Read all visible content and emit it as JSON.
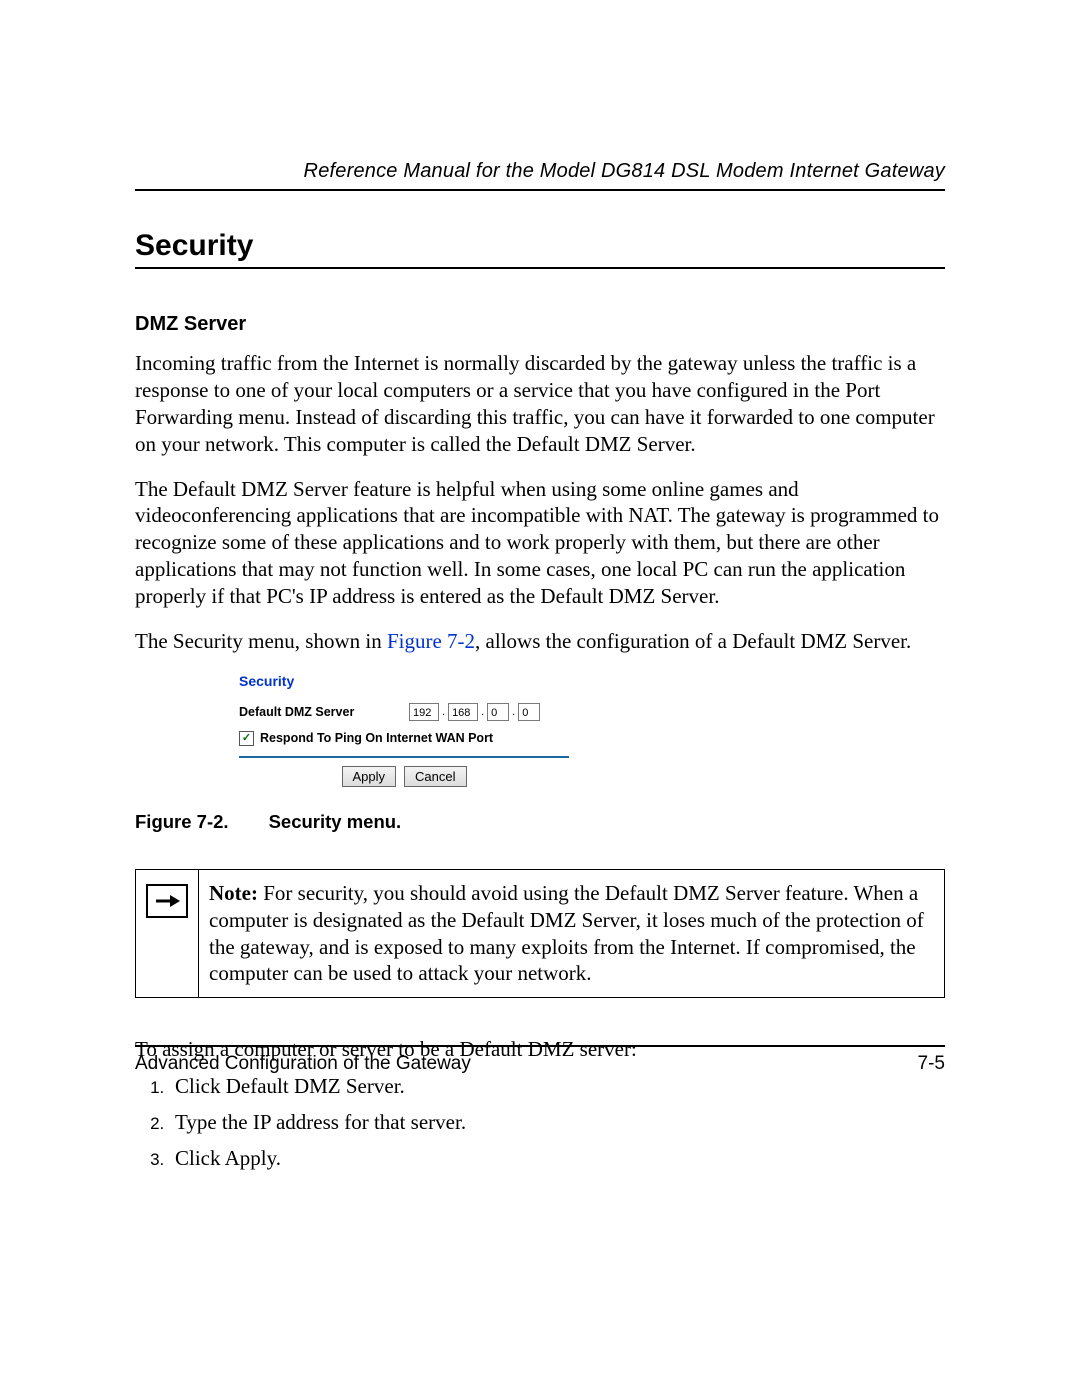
{
  "header": {
    "running": "Reference Manual for the Model DG814 DSL Modem Internet Gateway"
  },
  "section": {
    "title": "Security",
    "sub": "DMZ Server"
  },
  "para1": "Incoming traffic from the Internet is normally discarded by the gateway unless the traffic is a response to one of your local computers or a service that you have configured in the Port Forwarding menu. Instead of discarding this traffic, you can have it forwarded to one computer on your network. This computer is called the Default DMZ Server.",
  "para2": "The Default DMZ Server feature is helpful when using some online games and videoconferencing applications that are incompatible with NAT. The gateway is programmed to recognize some of these applications and to work properly with them, but there are other applications that may not function well. In some cases, one local PC can run the application properly if that PC's IP address is entered as the Default DMZ Server.",
  "para3_a": "The Security menu, shown in ",
  "para3_link": "Figure 7-2",
  "para3_b": ", allows the configuration of a Default DMZ Server.",
  "panel": {
    "title": "Security",
    "dmz_label": "Default DMZ Server",
    "ip": {
      "o1": "192",
      "o2": "168",
      "o3": "0",
      "o4": "0"
    },
    "respond_label": "Respond To Ping On Internet WAN Port",
    "respond_checked": "✓",
    "apply": "Apply",
    "cancel": "Cancel"
  },
  "figure": {
    "num": "Figure 7-2.",
    "title": "Security menu."
  },
  "note": {
    "label": "Note:",
    "text": " For security, you should avoid using the Default DMZ Server feature. When a computer is designated as the Default DMZ Server, it loses much of the protection of the gateway, and is exposed to many exploits from the Internet. If compromised, the computer can be used to attack your network."
  },
  "para4": "To assign a computer or server to be a Default DMZ server:",
  "steps": {
    "s1": "Click Default DMZ Server.",
    "s2": "Type the IP address for that server.",
    "s3": "Click Apply."
  },
  "footer": {
    "left": "Advanced Configuration of the Gateway",
    "right": "7-5"
  }
}
